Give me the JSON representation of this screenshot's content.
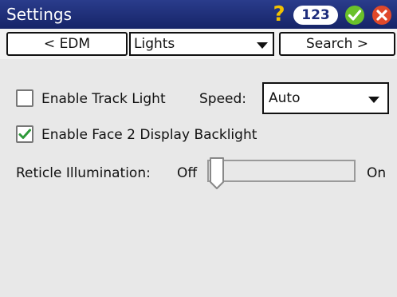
{
  "titlebar": {
    "title": "Settings",
    "help_icon": "?",
    "keyboard_label": "123",
    "ok_icon": "check-circle-icon",
    "close_icon": "close-circle-icon",
    "colors": {
      "bar": "#1f2f80",
      "help": "#f2c200",
      "ok": "#6ac12a",
      "close": "#e0482a"
    }
  },
  "nav": {
    "back_label": "< EDM",
    "page_select": "Lights",
    "next_label": "Search >"
  },
  "lights": {
    "track_light": {
      "label": "Enable Track Light",
      "checked": false
    },
    "speed": {
      "label": "Speed:",
      "value": "Auto"
    },
    "face2_backlight": {
      "label": "Enable Face 2 Display Backlight",
      "checked": true
    },
    "reticle": {
      "label": "Reticle Illumination:",
      "off_label": "Off",
      "on_label": "On",
      "level": 0
    }
  }
}
